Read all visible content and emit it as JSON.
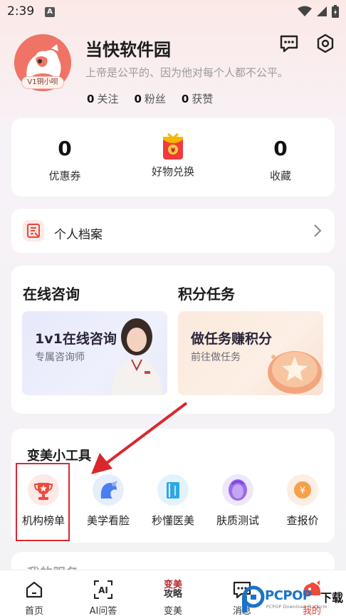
{
  "status_bar": {
    "time": "2:39",
    "notif_letter": "A"
  },
  "profile": {
    "avatar_tag": "V1铜小呗",
    "name": "当快软件园",
    "motto": "上帝是公平的、因为他对每个人都不公平。",
    "stats": [
      {
        "num": "0",
        "label": "关注"
      },
      {
        "num": "0",
        "label": "粉丝"
      },
      {
        "num": "0",
        "label": "获赞"
      }
    ]
  },
  "header_icons": [
    "message-icon",
    "settings-icon"
  ],
  "metrics": {
    "coupons": {
      "value": "0",
      "label": "优惠券"
    },
    "exchange": {
      "label": "好物兑换"
    },
    "favorites": {
      "value": "0",
      "label": "收藏"
    }
  },
  "profile_row": {
    "label": "个人档案"
  },
  "consult": {
    "title_left": "在线咨询",
    "title_right": "积分任务",
    "promo_left": {
      "title": "1v1在线咨询",
      "subtitle": "专属咨询师"
    },
    "promo_right": {
      "title": "做任务赚积分",
      "subtitle": "前往做任务"
    }
  },
  "tools": {
    "title": "变美小工具",
    "items": [
      {
        "label": "机构榜单",
        "icon": "trophy-icon",
        "bg": "#fde9e6"
      },
      {
        "label": "美学看脸",
        "icon": "face-icon",
        "bg": "#e6eefc"
      },
      {
        "label": "秒懂医美",
        "icon": "book-icon",
        "bg": "#e3f3fb"
      },
      {
        "label": "肤质测试",
        "icon": "skin-icon",
        "bg": "#efe7fb"
      },
      {
        "label": "查报价",
        "icon": "price-icon",
        "bg": "#fdeee3"
      }
    ]
  },
  "next_section_title": "我的服务",
  "nav": {
    "items": [
      {
        "label": "首页",
        "icon": "home-icon"
      },
      {
        "label": "AI问答",
        "icon": "ai-icon",
        "icon_text": "AI"
      },
      {
        "label": "变美",
        "icon": "beauty-icon",
        "icon_text_1": "变美",
        "icon_text_2": "攻略"
      },
      {
        "label": "消息",
        "icon": "message-icon"
      },
      {
        "label": "我的",
        "icon": "mine-icon"
      }
    ]
  },
  "watermark": {
    "brand": "PCPOP",
    "cn": "下载",
    "sub": "PCPOP Download Platform"
  },
  "colors": {
    "accent_red": "#d9272e",
    "avatar": "#f07466"
  }
}
